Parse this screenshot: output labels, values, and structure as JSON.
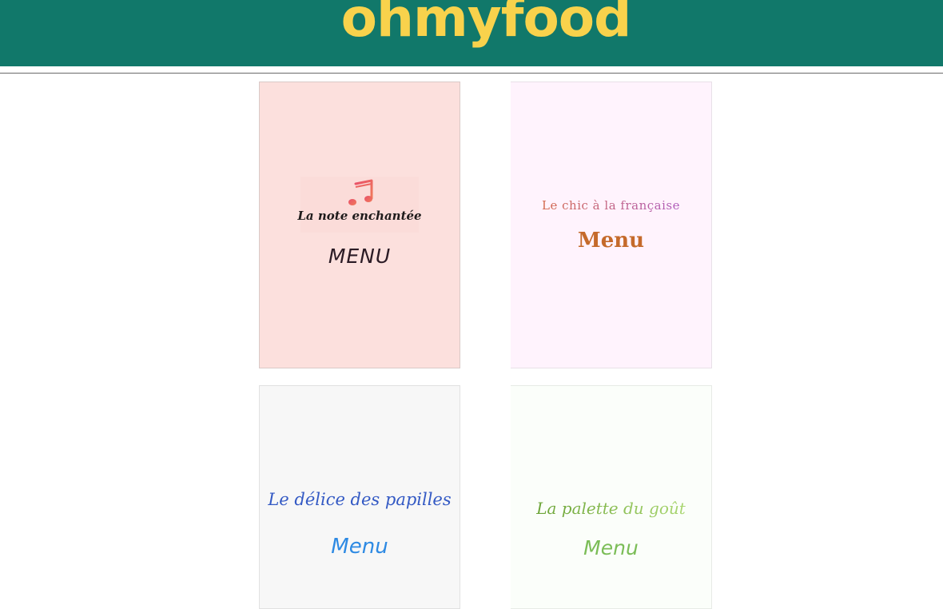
{
  "header": {
    "brand": "ohmyfood",
    "colors": {
      "background": "#11786a",
      "brand_text": "#f8d24c"
    }
  },
  "cards": [
    {
      "name": "La note enchantée",
      "menu_label": "MENU",
      "icon": "music-note-icon",
      "background": "#fce0dd"
    },
    {
      "name": "Le chic à la française",
      "menu_label": "Menu",
      "background": "#fff3fd"
    },
    {
      "name": "Le délice des papilles",
      "menu_label": "Menu",
      "background": "#f7f7f7"
    },
    {
      "name": "La palette du goût",
      "menu_label": "Menu",
      "background": "#fbfefa"
    }
  ]
}
